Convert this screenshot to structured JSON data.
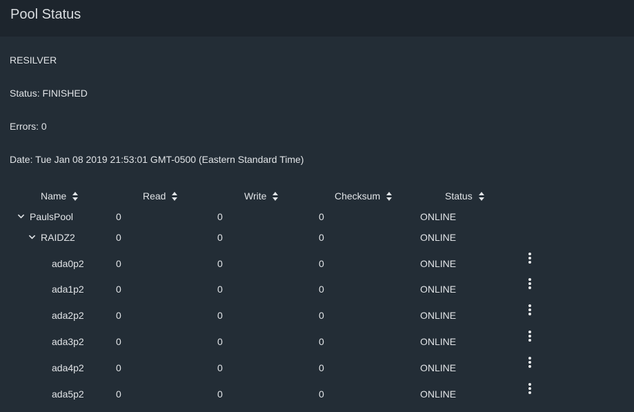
{
  "header": {
    "title": "Pool Status"
  },
  "scan": {
    "type": "RESILVER",
    "status": "Status: FINISHED",
    "errors": "Errors: 0",
    "date": "Date: Tue Jan 08 2019 21:53:01 GMT-0500 (Eastern Standard Time)"
  },
  "table": {
    "columns": [
      "Name",
      "Read",
      "Write",
      "Checksum",
      "Status"
    ],
    "rows": [
      {
        "name": "PaulsPool",
        "read": "0",
        "write": "0",
        "checksum": "0",
        "status": "ONLINE"
      },
      {
        "name": "RAIDZ2",
        "read": "0",
        "write": "0",
        "checksum": "0",
        "status": "ONLINE"
      },
      {
        "name": "ada0p2",
        "read": "0",
        "write": "0",
        "checksum": "0",
        "status": "ONLINE"
      },
      {
        "name": "ada1p2",
        "read": "0",
        "write": "0",
        "checksum": "0",
        "status": "ONLINE"
      },
      {
        "name": "ada2p2",
        "read": "0",
        "write": "0",
        "checksum": "0",
        "status": "ONLINE"
      },
      {
        "name": "ada3p2",
        "read": "0",
        "write": "0",
        "checksum": "0",
        "status": "ONLINE"
      },
      {
        "name": "ada4p2",
        "read": "0",
        "write": "0",
        "checksum": "0",
        "status": "ONLINE"
      },
      {
        "name": "ada5p2",
        "read": "0",
        "write": "0",
        "checksum": "0",
        "status": "ONLINE"
      }
    ]
  },
  "icons": {
    "expand": "chevron-down-icon",
    "actions": "more-vertical-icon",
    "sort": "sort-icon"
  }
}
